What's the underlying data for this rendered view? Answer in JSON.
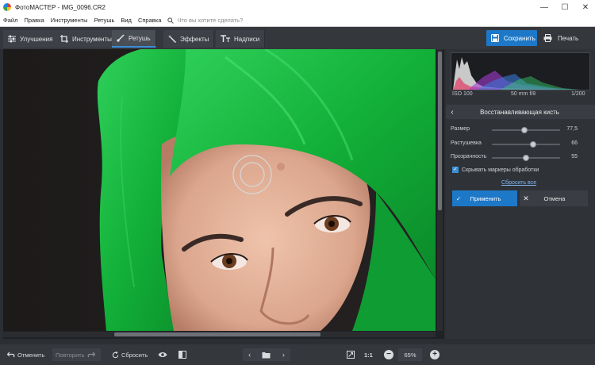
{
  "window": {
    "title": "ФотоМАСТЕР - IMG_0096.CR2",
    "minimize_glyph": "—",
    "maximize_glyph": "☐",
    "close_glyph": "✕"
  },
  "menu": {
    "items": [
      "Файл",
      "Правка",
      "Инструменты",
      "Ретушь",
      "Вид",
      "Справка"
    ],
    "search_placeholder": "Что вы хотите сделать?"
  },
  "toolbar": {
    "tabs": [
      {
        "label": "Улучшения",
        "icon": "sliders-icon",
        "active": false
      },
      {
        "label": "Инструменты",
        "icon": "crop-icon",
        "active": false
      },
      {
        "label": "Ретушь",
        "icon": "brush-icon",
        "active": true
      },
      {
        "label": "Эффекты",
        "icon": "magic-wand-icon",
        "active": false
      },
      {
        "label": "Надписи",
        "icon": "text-icon",
        "active": false
      }
    ],
    "save_label": "Сохранить",
    "print_label": "Печать"
  },
  "panel": {
    "exif": {
      "iso": "ISO 100",
      "lens": "50 mm f/8",
      "shutter": "1/200"
    },
    "tool_title": "Восстанавливающая кисть",
    "back_glyph": "‹",
    "sliders": [
      {
        "label": "Размер",
        "value": "77,5",
        "position": 0.48
      },
      {
        "label": "Растушевка",
        "value": "66",
        "position": 0.6
      },
      {
        "label": "Прозрачность",
        "value": "55",
        "position": 0.5
      }
    ],
    "hide_markers_label": "Скрывать маркеры обработки",
    "hide_markers_checked": true,
    "reset_all_label": "Сбросить все",
    "apply_label": "Применить",
    "cancel_label": "Отмена",
    "apply_glyph": "✓",
    "cancel_glyph": "✕"
  },
  "bottombar": {
    "undo_label": "Отменить",
    "redo_label": "Повторить",
    "reset_label": "Сбросить",
    "prev_glyph": "‹",
    "next_glyph": "›",
    "ratio_label": "1:1",
    "zoom_value": "65%",
    "zoom_out_glyph": "−",
    "zoom_in_glyph": "+"
  },
  "colors": {
    "accent": "#1e78c8",
    "panel_bg": "#2f3237",
    "hair_green": "#13b33a",
    "skin": "#e5b49c"
  }
}
